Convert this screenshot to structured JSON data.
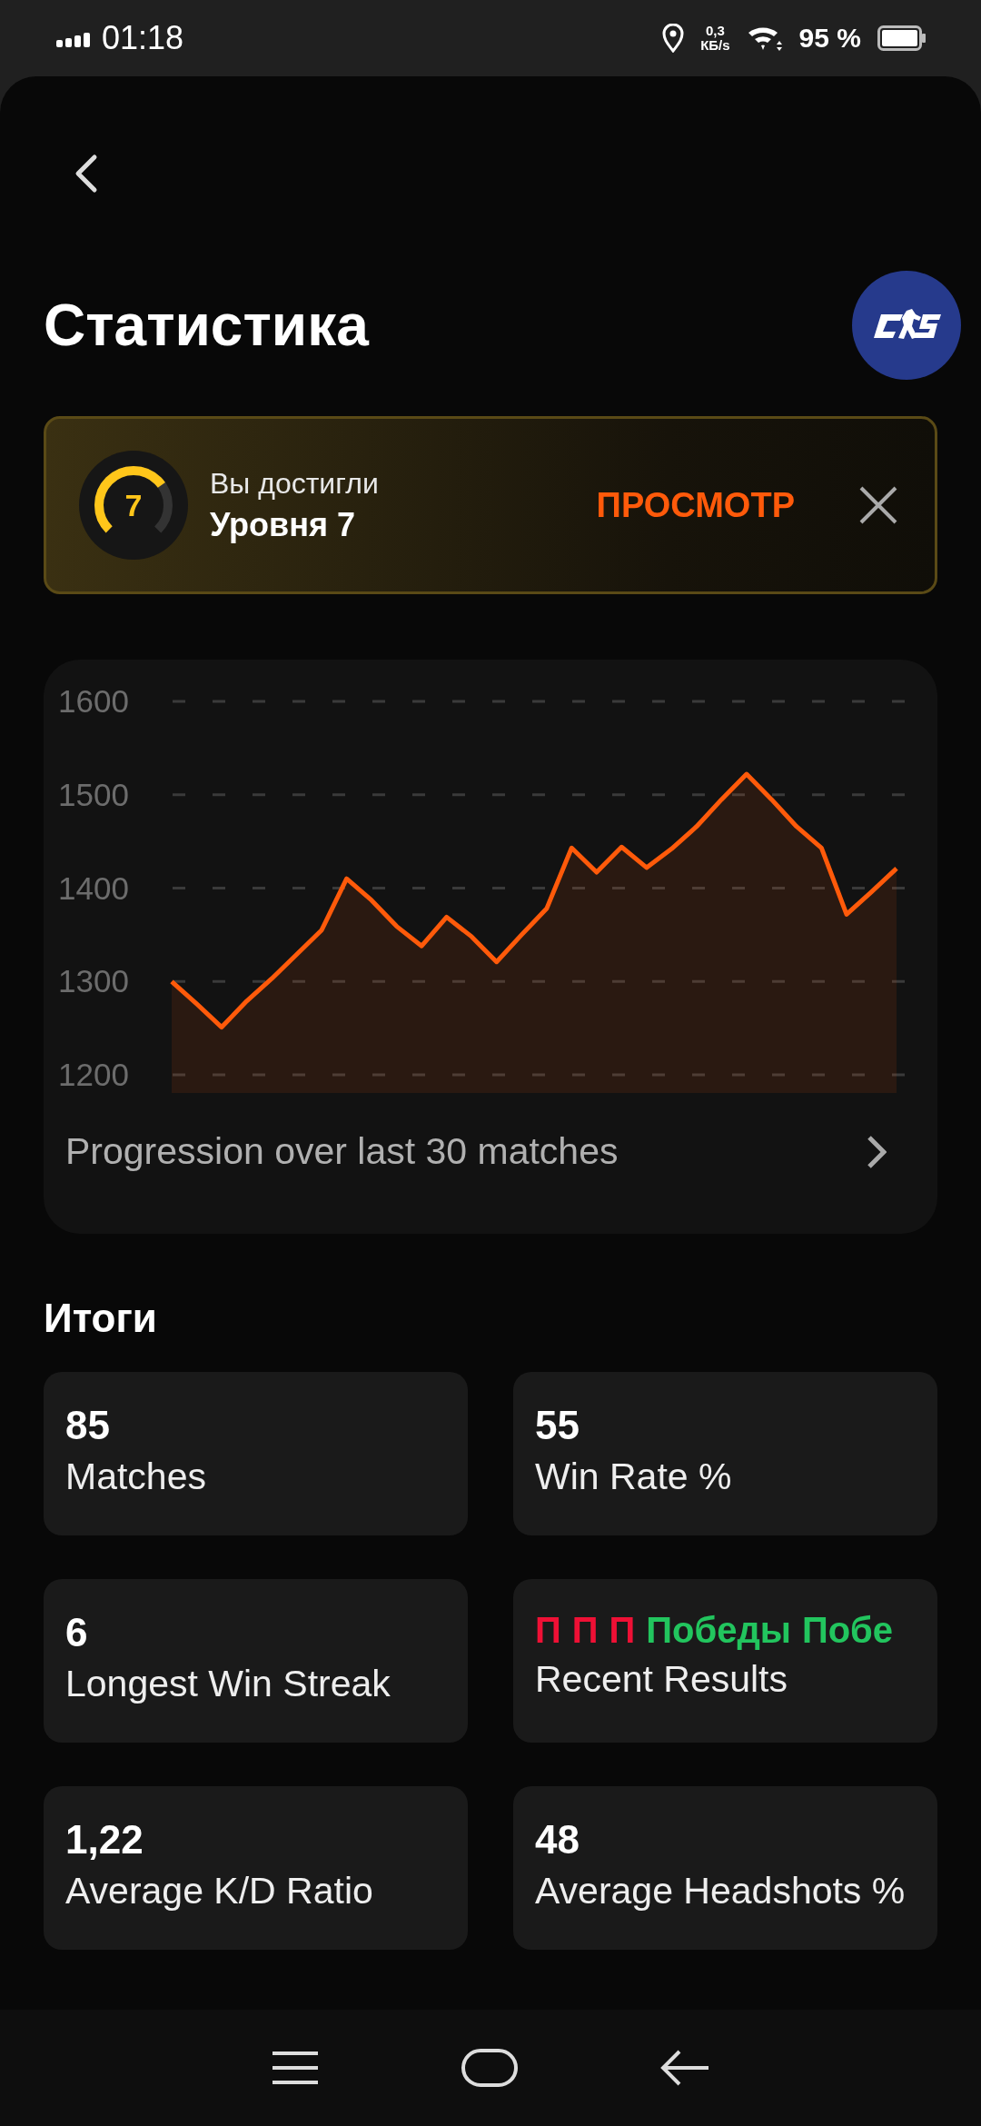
{
  "status_bar": {
    "time": "01:18",
    "speed_value": "0,3",
    "speed_unit": "КБ/s",
    "battery": "95 %"
  },
  "title": "Статистика",
  "banner": {
    "gauge_value": "7",
    "level": 0.7,
    "line1": "Вы достигли",
    "line2": "Уровня 7",
    "action": "ПРОСМОТР"
  },
  "chart": {
    "caption": "Progression over last 30 matches",
    "chart_data": {
      "type": "area",
      "grid": true,
      "ylim": [
        1200,
        1600
      ],
      "yticks": [
        1200,
        1300,
        1400,
        1500,
        1600
      ],
      "series": [
        {
          "color": "#ff5a0a",
          "values": [
            1300,
            1276,
            1251,
            1279,
            1303,
            1329,
            1355,
            1410,
            1387,
            1359,
            1338,
            1369,
            1348,
            1321,
            1350,
            1378,
            1443,
            1417,
            1444,
            1422,
            1442,
            1466,
            1495,
            1522,
            1495,
            1466,
            1443,
            1372,
            1396,
            1421
          ]
        }
      ]
    }
  },
  "summary": {
    "heading": "Итоги",
    "tiles": [
      {
        "kind": "value",
        "value": "85",
        "label": "Matches"
      },
      {
        "kind": "value",
        "value": "55",
        "label": "Win Rate %"
      },
      {
        "kind": "value",
        "value": "6",
        "label": "Longest Win Streak"
      },
      {
        "kind": "results",
        "results": [
          {
            "kind": "loss",
            "text": "П"
          },
          {
            "kind": "loss",
            "text": "П"
          },
          {
            "kind": "loss",
            "text": "П"
          },
          {
            "kind": "win",
            "text": "Победы"
          },
          {
            "kind": "win",
            "text": "Побе"
          }
        ],
        "label": "Recent Results"
      },
      {
        "kind": "value",
        "value": "1,22",
        "label": "Average K/D Ratio"
      },
      {
        "kind": "value",
        "value": "48",
        "label": "Average Headshots %"
      }
    ]
  }
}
